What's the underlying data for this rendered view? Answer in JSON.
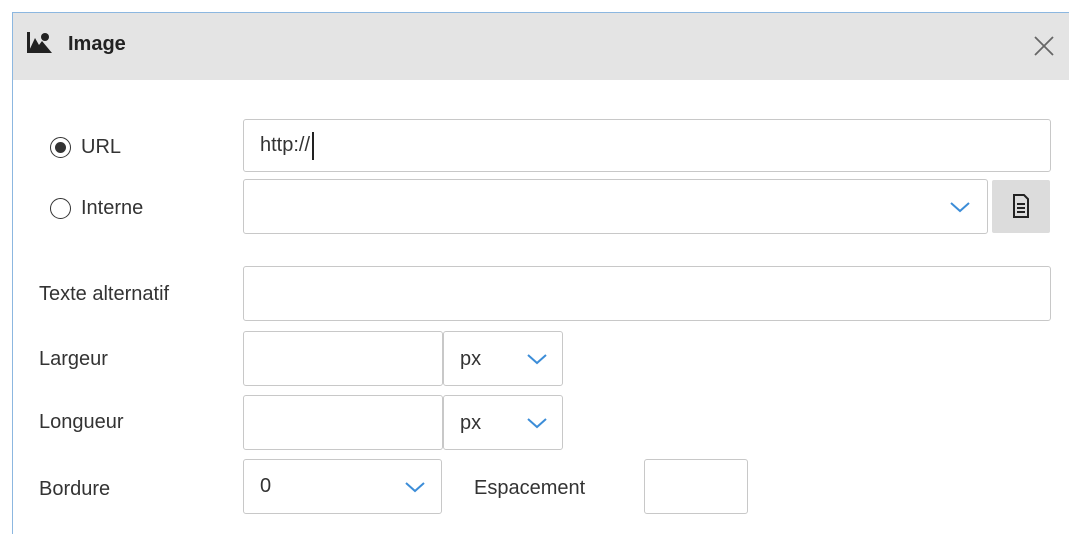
{
  "dialog": {
    "title": "Image",
    "title_icon": "image-icon",
    "close_icon": "close-icon"
  },
  "source": {
    "url_label": "URL",
    "url_selected": true,
    "url_value": "http://",
    "internal_label": "Interne",
    "internal_selected": false,
    "internal_value": "",
    "browse_icon": "document-icon"
  },
  "form": {
    "alt_label": "Texte alternatif",
    "alt_value": "",
    "width_label": "Largeur",
    "width_value": "",
    "width_unit": "px",
    "height_label": "Longueur",
    "height_value": "",
    "height_unit": "px",
    "border_label": "Bordure",
    "border_value": "0",
    "spacing_label": "Espacement",
    "spacing_value": ""
  },
  "colors": {
    "accent": "#3c8dd8",
    "titlebar_bg": "#e4e4e4",
    "border": "#c8c8c8"
  }
}
